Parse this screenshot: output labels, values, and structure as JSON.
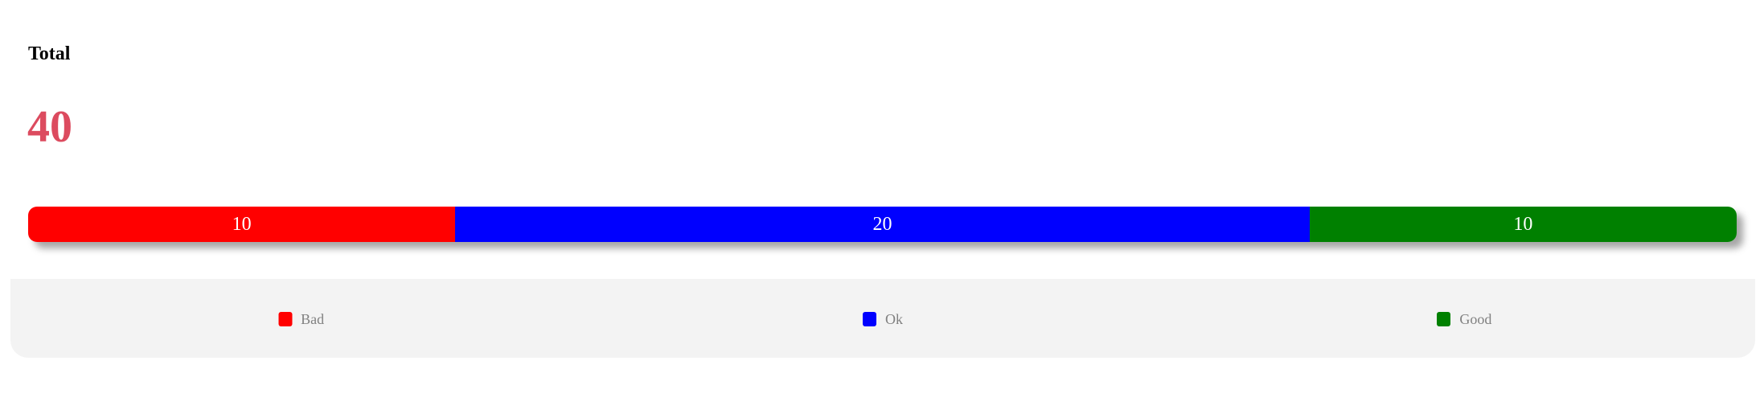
{
  "header": {
    "total_label": "Total",
    "total_value": "40",
    "total_color": "#dc4b5f"
  },
  "chart_data": {
    "type": "bar",
    "orientation": "horizontal-stacked",
    "categories": [
      "Bad",
      "Ok",
      "Good"
    ],
    "values": [
      10,
      20,
      10
    ],
    "total": 40,
    "colors": [
      "#ff0000",
      "#0000ff",
      "#008000"
    ],
    "legend_position": "bottom"
  }
}
